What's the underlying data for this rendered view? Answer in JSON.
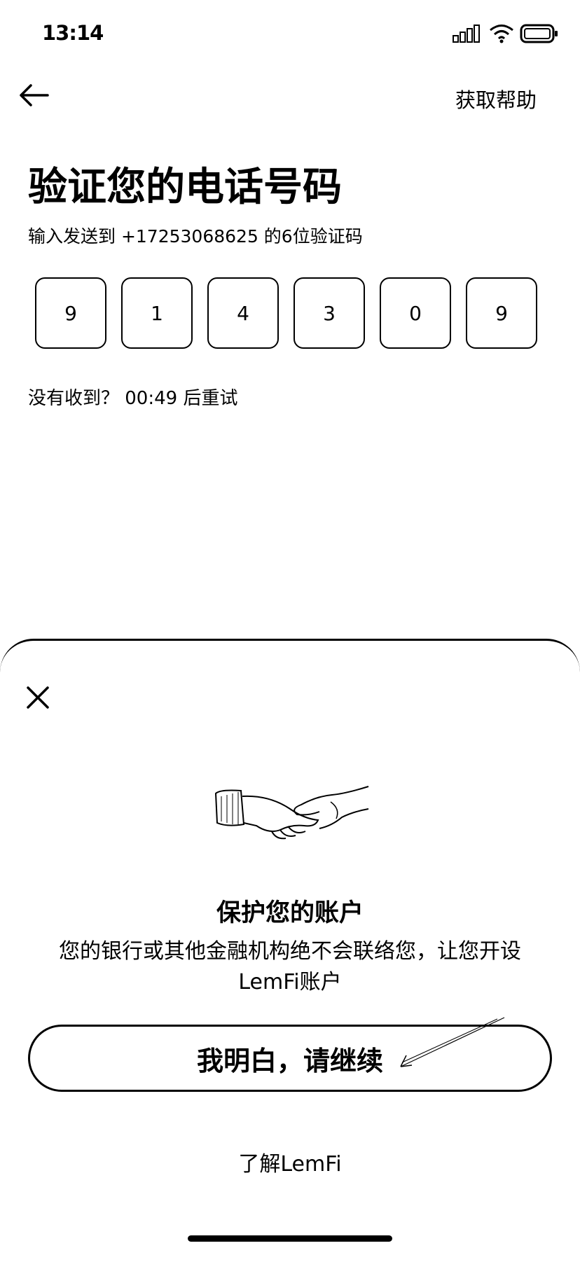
{
  "status_bar": {
    "time": "13:14",
    "icons": [
      "signal-icon",
      "wifi-icon",
      "battery-icon"
    ]
  },
  "header": {
    "back_icon": "arrow-left-icon",
    "help_label": "获取帮助"
  },
  "main": {
    "title": "验证您的电话号码",
    "subtitle": "输入发送到 +17253068625 的6位验证码",
    "otp_digits": [
      "9",
      "1",
      "4",
      "3",
      "0",
      "9"
    ],
    "resend_text": "没有收到？ 00:49 后重试"
  },
  "sheet": {
    "close_icon": "close-icon",
    "illustration": "handshake-illustration",
    "title": "保护您的账户",
    "description": "您的银行或其他金融机构绝不会联络您，让您开设LemFi账户",
    "confirm_label": "我明白，请继续",
    "learn_more_label": "了解LemFi"
  },
  "colors": {
    "foreground": "#000000",
    "background": "#ffffff"
  }
}
